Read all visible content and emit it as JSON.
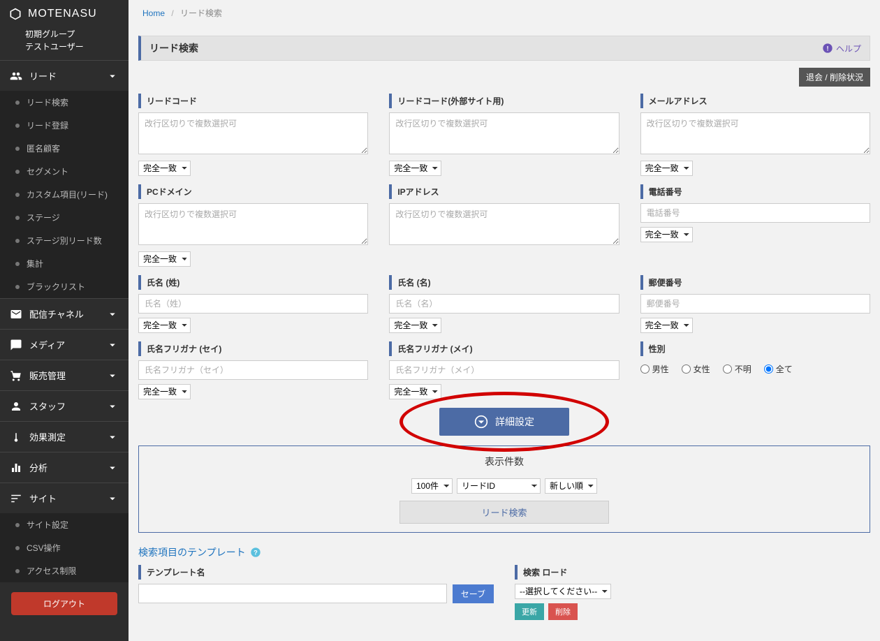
{
  "brand": "MOTENASU",
  "user": {
    "group": "初期グループ",
    "name": "テストユーザー"
  },
  "nav": {
    "lead": {
      "label": "リード",
      "items": [
        "リード検索",
        "リード登録",
        "匿名顧客",
        "セグメント",
        "カスタム項目(リード)",
        "ステージ",
        "ステージ別リード数",
        "集計",
        "ブラックリスト"
      ]
    },
    "channel": "配信チャネル",
    "media": "メディア",
    "sales": "販売管理",
    "staff": "スタッフ",
    "effect": "効果測定",
    "analysis": "分析",
    "site": {
      "label": "サイト",
      "items": [
        "サイト設定",
        "CSV操作",
        "アクセス制限"
      ]
    }
  },
  "logout": "ログアウト",
  "breadcrumb": {
    "home": "Home",
    "current": "リード検索"
  },
  "page": {
    "title": "リード検索",
    "help": "ヘルプ"
  },
  "status_btn": "退会 / 削除状況",
  "ph_multi": "改行区切りで複数選択可",
  "match_opt": "完全一致",
  "fields": {
    "lead_code": "リードコード",
    "lead_code_ext": "リードコード(外部サイト用)",
    "email": "メールアドレス",
    "pc_domain": "PCドメイン",
    "ip": "IPアドレス",
    "phone": "電話番号",
    "phone_ph": "電話番号",
    "lastname": "氏名 (姓)",
    "lastname_ph": "氏名（姓）",
    "firstname": "氏名 (名)",
    "firstname_ph": "氏名（名）",
    "postal": "郵便番号",
    "postal_ph": "郵便番号",
    "lastname_kana": "氏名フリガナ (セイ)",
    "lastname_kana_ph": "氏名フリガナ（セイ）",
    "firstname_kana": "氏名フリガナ (メイ)",
    "firstname_kana_ph": "氏名フリガナ（メイ）",
    "gender": "性別"
  },
  "gender_opts": {
    "male": "男性",
    "female": "女性",
    "unknown": "不明",
    "all": "全て"
  },
  "detail_btn": "詳細設定",
  "display": {
    "title": "表示件数",
    "count": "100件",
    "sort": "リードID",
    "order": "新しい順",
    "search": "リード検索"
  },
  "template": {
    "title": "検索項目のテンプレート",
    "name_label": "テンプレート名",
    "save": "セーブ",
    "load_label": "検索 ロード",
    "load_placeholder": "--選択してください--",
    "update": "更新",
    "delete": "削除"
  }
}
